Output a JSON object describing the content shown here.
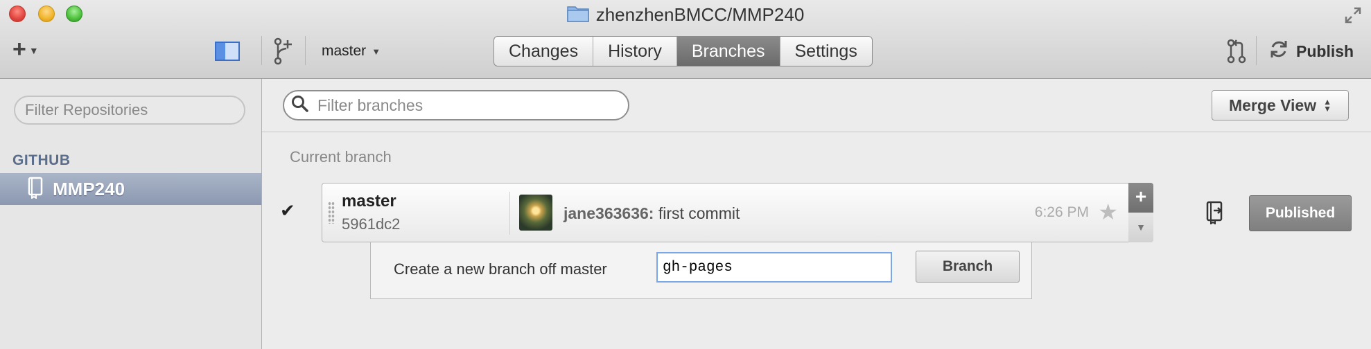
{
  "window": {
    "title": "zhenzhenBMCC/MMP240"
  },
  "toolbar": {
    "add_symbol": "+",
    "current_branch": "master",
    "tabs": [
      {
        "label": "Changes"
      },
      {
        "label": "History"
      },
      {
        "label": "Branches",
        "active": true
      },
      {
        "label": "Settings"
      }
    ],
    "publish_label": "Publish"
  },
  "sidebar": {
    "filter_placeholder": "Filter Repositories",
    "section_header": "GITHUB",
    "repos": [
      {
        "name": "MMP240",
        "selected": true
      }
    ]
  },
  "main": {
    "filter_placeholder": "Filter branches",
    "merge_view_label": "Merge View",
    "current_branch_label": "Current branch",
    "branch": {
      "name": "master",
      "sha": "5961dc2",
      "author": "jane363636:",
      "message": " first commit",
      "time": "6:26 PM",
      "status": "Published"
    },
    "new_branch": {
      "label": "Create a new branch off master",
      "input_value": "gh-pages",
      "button_label": "Branch"
    }
  },
  "colors": {
    "accent": "#3b6fc6",
    "selected_row": "#8b98b0",
    "active_tab": "#7a7a7a"
  }
}
